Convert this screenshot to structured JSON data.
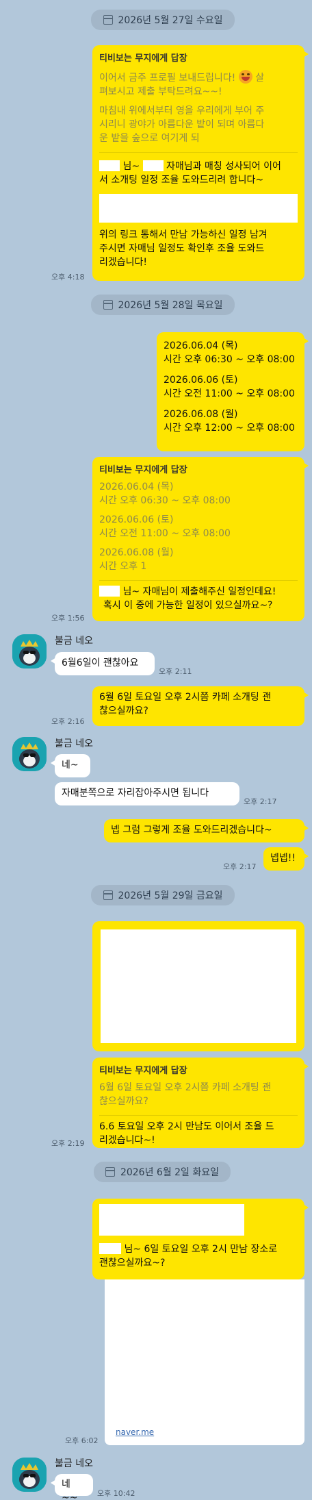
{
  "dates": {
    "d1": "2026년 5월 27일 수요일",
    "d2": "2026년 5월 28일 목요일",
    "d3": "2026년 5월 29일 금요일",
    "d4": "2026년 6월 2일 화요일"
  },
  "sender": {
    "name": "불금 네오"
  },
  "messages": {
    "m1": {
      "reply_header": "티비보는 무지에게 답장",
      "quote_line1": "이어서 금주 프로필 보내드립니다!",
      "quote_line1b": "살",
      "quote_line2": "펴보시고 제출 부탁드려요~~!",
      "quote_line3": "마침내 위에서부터 영을 우리에게 부어 주",
      "quote_line4": "시리니 광야가 아름다운 밭이 되며 아름다",
      "quote_line5": "운 밭을 숲으로 여기게 되",
      "body_a": "님~",
      "body_b": "자매님과 매칭 성사되어 이어",
      "body_c": "서 소개팅 일정 조율 도와드리려 합니다~",
      "body_d": "위의 링크 통해서 만남 가능하신 일정 남겨",
      "body_e": "주시면 자매님 일정도 확인후 조율 도와드",
      "body_f": "리겠습니다!",
      "time": "오후 4:18"
    },
    "m2": {
      "l1": "2026.06.04 (목)",
      "l2": "시간 오후 06:30 ~ 오후 08:00",
      "l3": "2026.06.06 (토)",
      "l4": "시간 오전 11:00 ~ 오후 08:00",
      "l5": "2026.06.08 (월)",
      "l6": "시간 오후 12:00 ~ 오후 08:00"
    },
    "m3": {
      "reply_header": "티비보는 무지에게 답장",
      "q1": "2026.06.04 (목)",
      "q2": "시간 오후 06:30 ~ 오후 08:00",
      "q3": "2026.06.06 (토)",
      "q4": "시간 오전 11:00 ~ 오후 08:00",
      "q5": "2026.06.08 (월)",
      "q6": "시간 오후 1",
      "body_a": "님~ 자매님이 제출해주신 일정인데요!",
      "body_b": "혹시 이 중에 가능한 일정이 있으실까요~?",
      "time": "오후 1:56"
    },
    "r1": {
      "text": "6월6일이 괜찮아요",
      "time": "오후 2:11"
    },
    "m4": {
      "l1": "6월 6일 토요일 오후 2시쯤 카페 소개팅 괜",
      "l2": "찮으실까요?",
      "time": "오후 2:16"
    },
    "r2": {
      "text": "네~"
    },
    "r3": {
      "text": "자매분쪽으로 자리잡아주시면 됩니다",
      "time": "오후 2:17"
    },
    "m5": {
      "text": "넵 그럼 그렇게 조율 도와드리겠습니다~"
    },
    "m6": {
      "text": "넵넵!!",
      "time": "오후 2:17"
    },
    "m7": {
      "reply_header": "티비보는 무지에게 답장",
      "q1": "6월 6일 토요일 오후 2시쯤 카페 소개팅 괜",
      "q2": "찮으실까요?",
      "b1": "6.6 토요일 오후 2시 만남도 이어서 조율 드",
      "b2": "리겠습니다~!",
      "time": "오후 2:19"
    },
    "m8": {
      "a": "님~ 6일 토요일 오후 2시 만남 장소로",
      "b": "괜찮으실까요~?",
      "link": "naver.me",
      "time": "오후 6:02"
    },
    "r4": {
      "text": "네~~",
      "time": "오후 10:42"
    }
  }
}
